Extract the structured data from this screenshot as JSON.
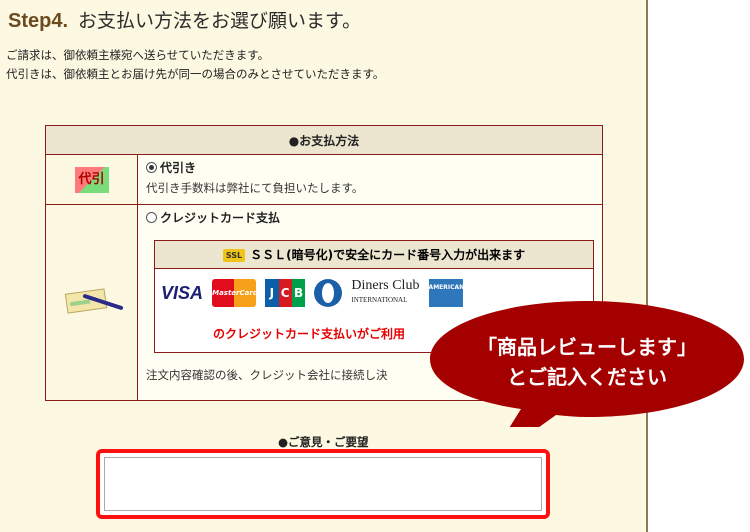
{
  "step": {
    "label": "Step4.",
    "title": "お支払い方法をお選び願います。"
  },
  "intro": {
    "line1": "ご請求は、御依頼主様宛へ送らせていただきます。",
    "line2": "代引きは、御依頼主とお届け先が同一の場合のみとさせていただきます。"
  },
  "payment": {
    "header": "●お支払方法",
    "cod": {
      "icon_text": "代引",
      "label": "代引き",
      "description": "代引き手数料は弊社にて負担いたします。",
      "selected": true
    },
    "credit": {
      "label": "クレジットカード支払",
      "selected": false,
      "ssl_tag": "SSL",
      "ssl_heading": "ＳＳＬ(暗号化)で安全にカード番号入力が出来ます",
      "cards": {
        "visa": "VISA",
        "mastercard": "MasterCard",
        "jcb": [
          "J",
          "C",
          "B"
        ],
        "diners_name": "Diners Club",
        "diners_sub": "INTERNATIONAL",
        "amex": "AMERICAN EXPRESS"
      },
      "note": "のクレジットカード支払いがご利用",
      "after_note": "注文内容確認の後、クレジット会社に接続し決"
    }
  },
  "opinion": {
    "label": "●ご意見・ご要望",
    "value": ""
  },
  "callout": {
    "line1": "「商品レビューします」",
    "line2": "とご記入ください",
    "color": "#a50000"
  }
}
